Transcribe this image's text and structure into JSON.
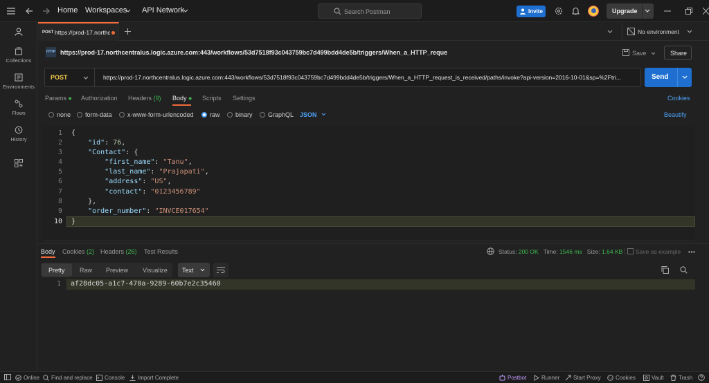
{
  "titlebar": {
    "home": "Home",
    "workspaces": "Workspaces",
    "workspace_name": "API Network",
    "search_placeholder": "Search Postman",
    "invite": "Invite",
    "upgrade": "Upgrade"
  },
  "sidebar": {
    "items": [
      {
        "label": "Collections",
        "icon": "collections-icon"
      },
      {
        "label": "Environments",
        "icon": "environments-icon"
      },
      {
        "label": "Flows",
        "icon": "flows-icon"
      },
      {
        "label": "History",
        "icon": "history-icon"
      }
    ]
  },
  "tab": {
    "method": "POST",
    "name": "https://prod-17.northcentralus.logic.azure.com"
  },
  "environment": "No environment",
  "request": {
    "title": "https://prod-17.northcentralus.logic.azure.com:443/workflows/53d7518f93c043759bc7d499bdd4de5b/triggers/When_a_HTTP_reque",
    "save": "Save",
    "share": "Share",
    "method": "POST",
    "url": "https://prod-17.northcentralus.logic.azure.com:443/workflows/53d7518f93c043759bc7d499bdd4de5b/triggers/When_a_HTTP_request_is_received/paths/invoke?api-version=2016-10-01&sp=%2Ftri...",
    "send": "Send"
  },
  "request_tabs": {
    "params": "Params",
    "authorization": "Authorization",
    "headers": "Headers",
    "headers_count": "(9)",
    "body": "Body",
    "scripts": "Scripts",
    "settings": "Settings",
    "cookies": "Cookies"
  },
  "body_types": {
    "none": "none",
    "form_data": "form-data",
    "urlencoded": "x-www-form-urlencoded",
    "raw": "raw",
    "binary": "binary",
    "graphql": "GraphQL",
    "json": "JSON",
    "beautify": "Beautify"
  },
  "editor": {
    "line_numbers": [
      "1",
      "2",
      "3",
      "4",
      "5",
      "6",
      "7",
      "8",
      "9",
      "10"
    ],
    "k_id": "\"id\"",
    "v_id": "76",
    "k_contact": "\"Contact\"",
    "k_first_name": "\"first_name\"",
    "v_first_name": "\"Tanu\"",
    "k_last_name": "\"last_name\"",
    "v_last_name": "\"Prajapati\"",
    "k_address": "\"address\"",
    "v_address": "\"US\"",
    "k_contact_num": "\"contact\"",
    "v_contact_num": "\"0123456789\"",
    "k_order": "\"order_number\"",
    "v_order": "\"INVCE017654\""
  },
  "response": {
    "tabs": {
      "body": "Body",
      "cookies": "Cookies",
      "cookies_count": "(2)",
      "headers": "Headers",
      "headers_count": "(26)",
      "test_results": "Test Results"
    },
    "status_label": "Status:",
    "status_value": "200 OK",
    "time_label": "Time:",
    "time_value": "1546 ms",
    "size_label": "Size:",
    "size_value": "1.64 KB",
    "save_example": "Save as example",
    "views": {
      "pretty": "Pretty",
      "raw": "Raw",
      "preview": "Preview",
      "visualize": "Visualize",
      "format": "Text"
    },
    "line_number": "1",
    "content": "af28dc05-a1c7-470a-9289-60b7e2c35460"
  },
  "statusbar": {
    "online": "Online",
    "find_replace": "Find and replace",
    "console": "Console",
    "import": "Import Complete",
    "postbot": "Postbot",
    "runner": "Runner",
    "start_proxy": "Start Proxy",
    "cookies": "Cookies",
    "vault": "Vault",
    "trash": "Trash"
  },
  "colors": {
    "accent": "#f26b3a",
    "primary": "#1f6fd1",
    "link": "#4ea0f5",
    "success": "#3fb950",
    "method_post": "#f0c74b"
  }
}
